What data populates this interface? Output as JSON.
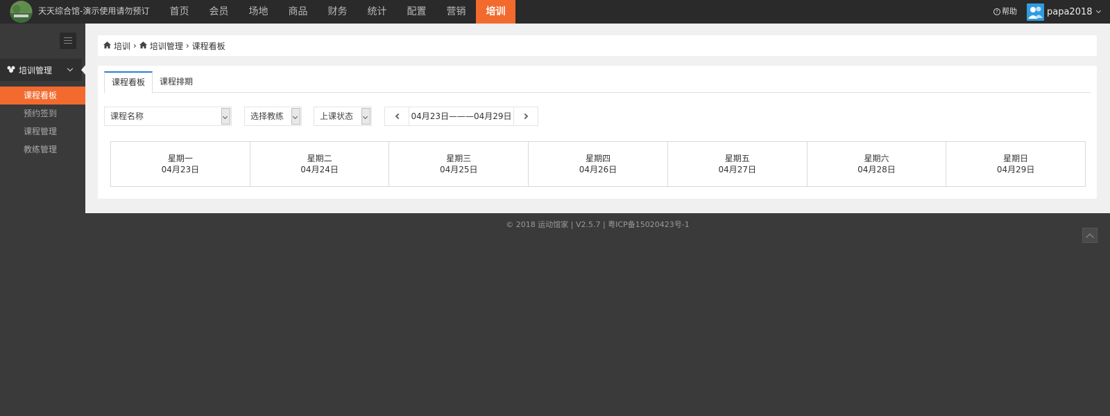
{
  "header": {
    "app_title": "天天综合馆-演示使用请勿预订",
    "nav": [
      "首页",
      "会员",
      "场地",
      "商品",
      "财务",
      "统计",
      "配置",
      "营销",
      "培训"
    ],
    "active_nav": "培训",
    "help_label": "帮助",
    "username": "papa2018",
    "accent_color": "#f26a2e"
  },
  "sidebar": {
    "section_label": "培训管理",
    "items": [
      {
        "label": "课程看板",
        "active": true
      },
      {
        "label": "预约签到",
        "active": false
      },
      {
        "label": "课程管理",
        "active": false
      },
      {
        "label": "教练管理",
        "active": false
      }
    ]
  },
  "breadcrumb": [
    "培训",
    "培训管理",
    "课程看板"
  ],
  "tabs": [
    {
      "label": "课程看板",
      "active": true
    },
    {
      "label": "课程排期",
      "active": false
    }
  ],
  "filters": {
    "course_name": "课程名称",
    "coach": "选择教练",
    "status": "上课状态"
  },
  "date_range": "04月23日———04月29日",
  "week": [
    {
      "weekday": "星期一",
      "date": "04月23日"
    },
    {
      "weekday": "星期二",
      "date": "04月24日"
    },
    {
      "weekday": "星期三",
      "date": "04月25日"
    },
    {
      "weekday": "星期四",
      "date": "04月26日"
    },
    {
      "weekday": "星期五",
      "date": "04月27日"
    },
    {
      "weekday": "星期六",
      "date": "04月28日"
    },
    {
      "weekday": "星期日",
      "date": "04月29日"
    }
  ],
  "footer": "© 2018 运动馆家 | V2.5.7 | 粤ICP备15020423号-1"
}
